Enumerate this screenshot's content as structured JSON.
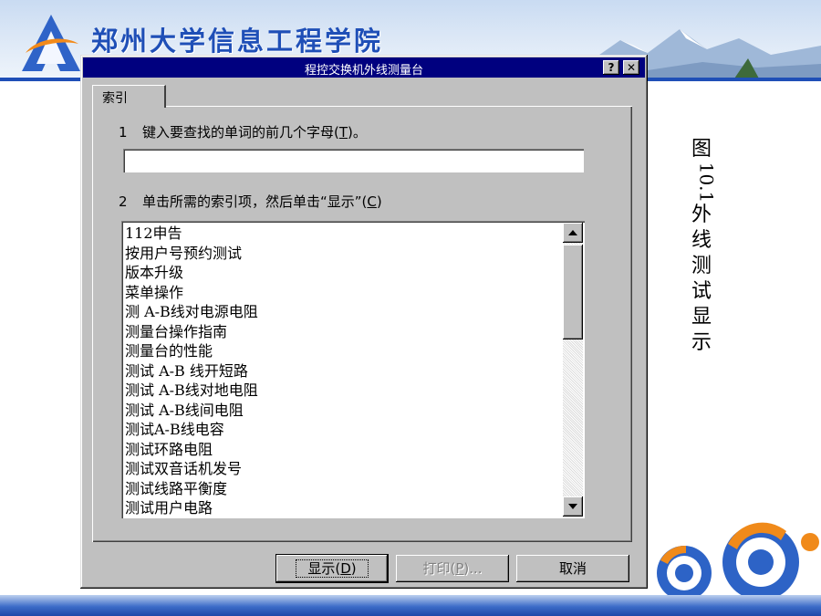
{
  "slide": {
    "school_name": "郑州大学信息工程学院",
    "caption_prefix": "图",
    "caption_number": "10.1",
    "caption_chars": [
      "外",
      "线",
      "测",
      "试",
      "显",
      "示"
    ]
  },
  "dialog": {
    "title": "程控交换机外线测量台",
    "help_button": "?",
    "close_button": "✕",
    "tab_label": "索引",
    "step1": {
      "num": "1",
      "text_before": "键入要查找的单词的前几个字母(",
      "hotkey": "T",
      "text_after": ")。"
    },
    "search_value": "",
    "step2": {
      "num": "2",
      "text_before": "单击所需的索引项，然后单击“显示”(",
      "hotkey": "C",
      "text_after": ")"
    },
    "list_items": [
      "112申告",
      "按用户号预约测试",
      "版本升级",
      "菜单操作",
      "测 A-B线对电源电阻",
      "测量台操作指南",
      "测量台的性能",
      "测试 A-B 线开短路",
      "测试 A-B线对地电阻",
      "测试 A-B线间电阻",
      "测试A-B线电容",
      "测试环路电阻",
      "测试双音话机发号",
      "测试线路平衡度",
      "测试用户电路"
    ],
    "buttons": {
      "show": {
        "text": "显示(",
        "hotkey": "D",
        "tail": ")"
      },
      "print": {
        "text": "打印(",
        "hotkey": "P",
        "tail": ")..."
      },
      "cancel": "取消"
    }
  }
}
